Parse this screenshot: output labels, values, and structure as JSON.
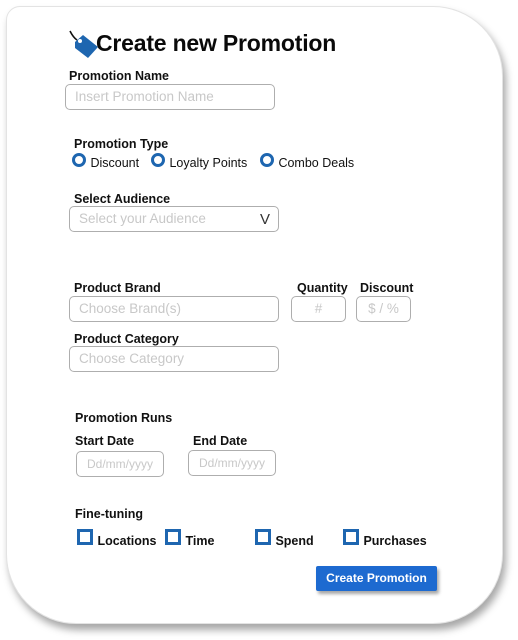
{
  "title": "Create new Promotion",
  "icon": "price-tag-icon",
  "accent_color": "#1e66b0",
  "button_color": "#1d6ad0",
  "promotion_name": {
    "label": "Promotion Name",
    "placeholder": "Insert Promotion Name"
  },
  "promotion_type": {
    "label": "Promotion Type",
    "options": [
      "Discount",
      "Loyalty Points",
      "Combo Deals"
    ]
  },
  "audience": {
    "label": "Select Audience",
    "placeholder": "Select your Audience",
    "chevron": "V"
  },
  "product_brand": {
    "label": "Product Brand",
    "placeholder": "Choose Brand(s)"
  },
  "quantity": {
    "label": "Quantity",
    "placeholder": "#"
  },
  "discount": {
    "label": "Discount",
    "placeholder": "$ / %"
  },
  "product_category": {
    "label": "Product Category",
    "placeholder": "Choose Category"
  },
  "runs": {
    "label": "Promotion Runs",
    "start_label": "Start Date",
    "start_placeholder": "Dd/mm/yyyy",
    "end_label": "End Date",
    "end_placeholder": "Dd/mm/yyyy"
  },
  "fine_tuning": {
    "label": "Fine-tuning",
    "options": [
      "Locations",
      "Time",
      "Spend",
      "Purchases"
    ]
  },
  "submit_label": "Create Promotion"
}
